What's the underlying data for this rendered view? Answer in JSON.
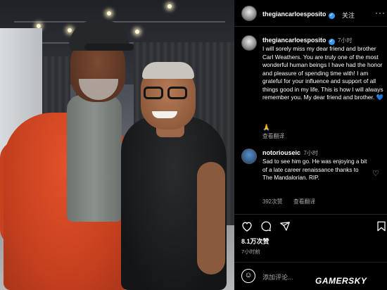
{
  "post_header": {
    "username": "thegiancarloesposito",
    "follow_label": "关注",
    "more_icon": "more-dots-icon"
  },
  "caption": {
    "username": "thegiancarloesposito",
    "time": "7小时",
    "text": "I will sorely miss my dear friend and brother Carl Weathers. You are truly one of the most wonderful human beings I have had the honor and pleasure of spending time with! I am grateful for your influence and support of all things good in my life. This is how I will always remember you. My dear friend and brother.",
    "emoji": "💙",
    "prayer_emoji": "🙏",
    "translate_label": "查看翻译"
  },
  "comment": {
    "username": "notoriouseic",
    "time": "7小时",
    "text": "Sad to see him go. He was enjoying a bit of a late career renaissance thanks to The Mandalorian. RIP.",
    "likes": "392次赞",
    "translate_label": "查看翻译"
  },
  "actions": {
    "like_icon": "heart-icon",
    "comment_icon": "comment-icon",
    "share_icon": "send-icon",
    "save_icon": "bookmark-icon"
  },
  "stats": {
    "likes": "8.1万次赞",
    "time_ago": "7小时前"
  },
  "composer": {
    "placeholder": "添加评论..."
  },
  "watermark": "GAMERSKY",
  "colors": {
    "verified": "#3897f0",
    "background": "#000000",
    "muted_text": "#a8a8a8"
  }
}
